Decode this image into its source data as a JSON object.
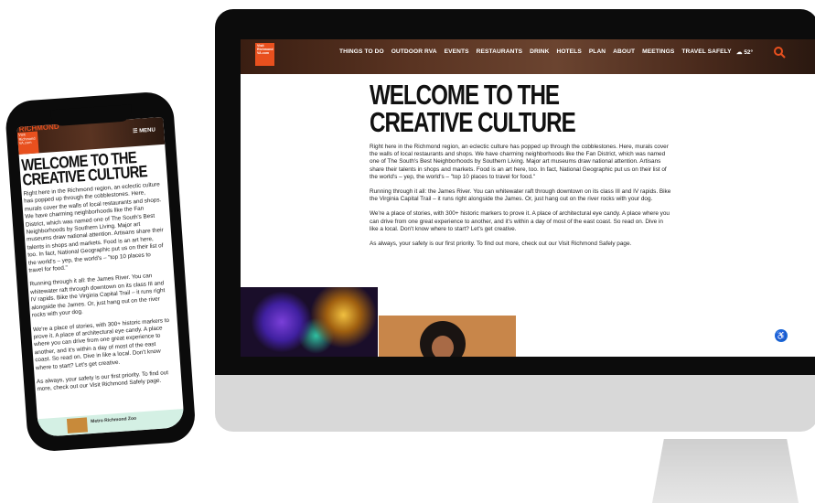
{
  "desktop": {
    "logo_text": "Visit Richmond VA.com",
    "nav_items": [
      "THINGS TO DO",
      "OUTDOOR RVA",
      "EVENTS",
      "RESTAURANTS",
      "DRINK",
      "HOTELS",
      "PLAN",
      "ABOUT",
      "MEETINGS",
      "TRAVEL SAFELY"
    ],
    "weather": "52°",
    "title": "WELCOME TO THE CREATIVE CULTURE",
    "paragraphs": [
      "Right here in the Richmond region, an eclectic culture has popped up through the cobblestones. Here, murals cover the walls of local restaurants and shops. We have charming neighborhoods like the Fan District, which was named one of The South's Best Neighborhoods by Southern Living. Major art museums draw national attention. Artisans share their talents in shops and markets. Food is an art here, too. In fact, National Geographic put us on their list of the world's – yep, the world's – \"top 10 places to travel for food.\"",
      "Running through it all: the James River. You can whitewater raft through downtown on its class III and IV rapids. Bike the Virginia Capital Trail – it runs right alongside the James. Or, just hang out on the river rocks with your dog.",
      "We're a place of stories, with 300+ historic markers to prove it. A place of architectural eye candy. A place where you can drive from one great experience to another, and it's within a day of most of the east coast. So read on. Dive in like a local. Don't know where to start? Let's get creative.",
      "As always, your safety is our first priority. To find out more, check out our Visit Richmond Safely page."
    ]
  },
  "phone": {
    "brand_text": "RICHMOND",
    "logo_text": "Visit Richmond VA.com",
    "menu_label": "☰ MENU",
    "title": "WELCOME TO THE CREATIVE CULTURE",
    "paragraphs": [
      "Right here in the Richmond region, an eclectic culture has popped up through the cobblestones. Here, murals cover the walls of local restaurants and shops. We have charming neighborhoods like the Fan District, which was named one of The South's Best Neighborhoods by Southern Living. Major art museums draw national attention. Artisans share their talents in shops and markets. Food is an art here, too. In fact, National Geographic put us on their list of the world's – yep, the world's – \"top 10 places to travel for food.\"",
      "Running through it all: the James River. You can whitewater raft through downtown on its class III and IV rapids. Bike the Virginia Capital Trail – it runs right alongside the James. Or, just hang out on the river rocks with your dog.",
      "We're a place of stories, with 300+ historic markers to prove it. A place of architectural eye candy. A place where you can drive from one great experience to another, and it's within a day of most of the east coast. So read on. Dive in like a local. Don't know where to start? Let's get creative.",
      "As always, your safety is our first priority. To find out more, check out our Visit Richmond Safely page."
    ],
    "ad_text": "Metro Richmond Zoo"
  },
  "colors": {
    "brand_orange": "#e8501e",
    "a11y_blue": "#1a66d8"
  }
}
